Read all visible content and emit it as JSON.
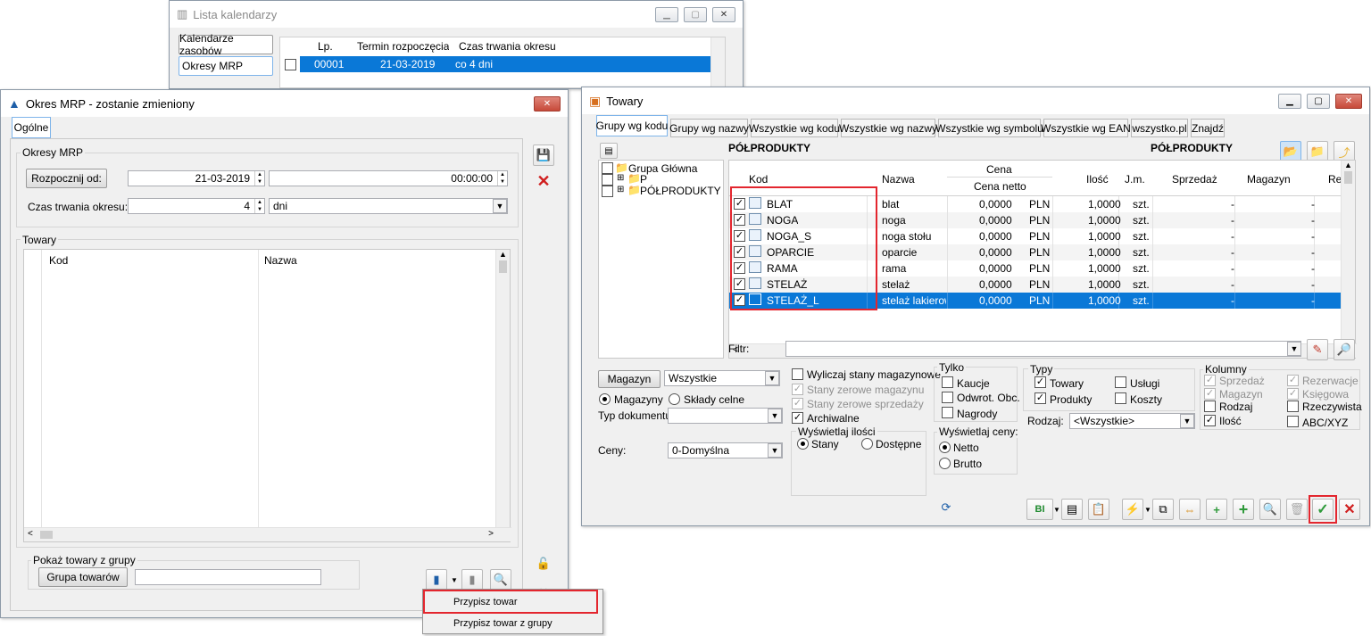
{
  "lista_kalendarzy": {
    "title": "Lista kalendarzy",
    "side_tabs": [
      "Kalendarze zasobów",
      "Okresy MRP"
    ],
    "columns": [
      "Lp.",
      "Termin rozpoczęcia",
      "Czas trwania okresu"
    ],
    "rows": [
      {
        "lp": "00001",
        "termin": "21-03-2019",
        "czas": "co 4 dni"
      }
    ]
  },
  "okres_mrp": {
    "title": "Okres MRP - zostanie zmieniony",
    "tab": "Ogólne",
    "group_okresy": "Okresy MRP",
    "rozpocznij_label": "Rozpocznij od:",
    "date_value": "21-03-2019",
    "time_value": "00:00:00",
    "czas_label": "Czas trwania okresu:",
    "czas_value": "4",
    "unit_value": "dni",
    "group_towary": "Towary",
    "grid_columns": [
      "Kod",
      "Nazwa"
    ],
    "group_pokaz": "Pokaż towary z grupy",
    "grupa_button": "Grupa towarów",
    "grupa_value": "",
    "menu": [
      "Przypisz towar",
      "Przypisz towar z grupy"
    ]
  },
  "towary": {
    "title": "Towary",
    "tabs": [
      "Grupy wg kodu",
      "Grupy wg nazwy",
      "Wszystkie wg kodu",
      "Wszystkie wg nazwy",
      "Wszystkie wg symbolu",
      "Wszystkie wg EAN",
      "wszystko.pl",
      "Znajdź"
    ],
    "tree_header": "PÓŁPRODUKTY",
    "grid_header": "PÓŁPRODUKTY",
    "tree": [
      "Grupa Główna",
      "P",
      "PÓŁPRODUKTY"
    ],
    "columns": {
      "kod": "Kod",
      "nazwa": "Nazwa",
      "cena": "Cena",
      "cena_netto": "Cena netto",
      "ilosc": "Ilość",
      "jm": "J.m.",
      "sprzedaz": "Sprzedaż",
      "magazyn": "Magazyn",
      "re": "Re"
    },
    "rows": [
      {
        "kod": "BLAT",
        "nazwa": "blat",
        "cena": "0,0000",
        "waluta": "PLN",
        "ilosc": "1,0000",
        "jm": "szt.",
        "sprzedaz": "-",
        "magazyn": "-"
      },
      {
        "kod": "NOGA",
        "nazwa": "noga",
        "cena": "0,0000",
        "waluta": "PLN",
        "ilosc": "1,0000",
        "jm": "szt.",
        "sprzedaz": "-",
        "magazyn": "-"
      },
      {
        "kod": "NOGA_S",
        "nazwa": "noga stołu",
        "cena": "0,0000",
        "waluta": "PLN",
        "ilosc": "1,0000",
        "jm": "szt.",
        "sprzedaz": "-",
        "magazyn": "-"
      },
      {
        "kod": "OPARCIE",
        "nazwa": "oparcie",
        "cena": "0,0000",
        "waluta": "PLN",
        "ilosc": "1,0000",
        "jm": "szt.",
        "sprzedaz": "-",
        "magazyn": "-"
      },
      {
        "kod": "RAMA",
        "nazwa": "rama",
        "cena": "0,0000",
        "waluta": "PLN",
        "ilosc": "1,0000",
        "jm": "szt.",
        "sprzedaz": "-",
        "magazyn": "-"
      },
      {
        "kod": "STELAŻ",
        "nazwa": "stelaż",
        "cena": "0,0000",
        "waluta": "PLN",
        "ilosc": "1,0000",
        "jm": "szt.",
        "sprzedaz": "-",
        "magazyn": "-"
      },
      {
        "kod": "STELAŻ_L",
        "nazwa": "stelaż lakierowa",
        "cena": "0,0000",
        "waluta": "PLN",
        "ilosc": "1,0000",
        "jm": "szt.",
        "sprzedaz": "-",
        "magazyn": "-"
      }
    ],
    "filtr_label": "Filtr:",
    "magazyn_button": "Magazyn",
    "magazyn_value": "Wszystkie",
    "radio_magazyny": "Magazyny",
    "radio_sklady": "Składy celne",
    "typ_dok_label": "Typ dokumentu:",
    "ceny_label": "Ceny:",
    "ceny_value": "0-Domyślna",
    "opts": [
      "Wyliczaj stany magazynowe",
      "Stany zerowe magazynu",
      "Stany zerowe sprzedaży",
      "Archiwalne"
    ],
    "wyswietlaj_ilosci": "Wyświetlaj ilości",
    "stany": "Stany",
    "dostepne": "Dostępne",
    "tylko": "Tylko",
    "tylko_opts": [
      "Kaucje",
      "Odwrot. Obc.",
      "Nagrody"
    ],
    "wyswietlaj_ceny": "Wyświetlaj ceny:",
    "netto": "Netto",
    "brutto": "Brutto",
    "typy": "Typy",
    "typy_opts": [
      "Towary",
      "Usługi",
      "Produkty",
      "Koszty"
    ],
    "rodzaj_label": "Rodzaj:",
    "rodzaj_value": "<Wszystkie>",
    "kolumny": "Kolumny",
    "kolumny_opts": [
      "Sprzedaż",
      "Rezerwacje",
      "Magazyn",
      "Księgowa",
      "Rodzaj",
      "Rzeczywista",
      "Ilość",
      "ABC/XYZ"
    ]
  },
  "colors": {
    "selection": "#0a78d7",
    "highlight": "#e3262e",
    "accent": "#3a86c8"
  }
}
